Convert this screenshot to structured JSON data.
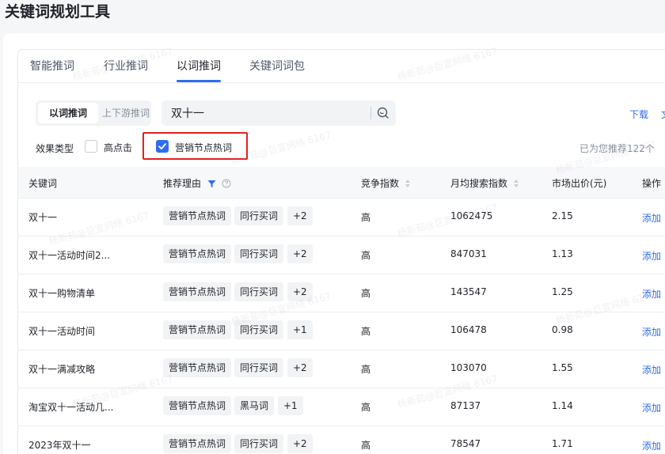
{
  "page": {
    "title": "关键词规划工具"
  },
  "tabs": [
    {
      "label": "智能推词",
      "active": false
    },
    {
      "label": "行业推词",
      "active": false
    },
    {
      "label": "以词推词",
      "active": true
    },
    {
      "label": "关键词词包",
      "active": false
    }
  ],
  "mode_switch": {
    "active": "以词推词",
    "inactive": "上下游推词"
  },
  "search": {
    "value": "双十一",
    "icon": "search-icon"
  },
  "actions": {
    "download": "下载",
    "extra": "文"
  },
  "filter": {
    "label": "效果类型",
    "options": [
      {
        "label": "高点击",
        "checked": false
      },
      {
        "label": "营销节点热词",
        "checked": true
      }
    ],
    "recommend_note": "已为您推荐122个"
  },
  "table": {
    "headers": {
      "keyword": "关键词",
      "reason": "推荐理由",
      "competition": "竞争指数",
      "monthly_search": "月均搜索指数",
      "market_bid": "市场出价(元)",
      "action": "操作"
    },
    "rows": [
      {
        "keyword": "双十一",
        "tags": [
          "营销节点热词",
          "同行买词",
          "+2"
        ],
        "competition": "高",
        "monthly_search": "1062475",
        "market_bid": "2.15",
        "action": "添加"
      },
      {
        "keyword": "双十一活动时间2...",
        "tags": [
          "营销节点热词",
          "同行买词",
          "+2"
        ],
        "competition": "高",
        "monthly_search": "847031",
        "market_bid": "1.13",
        "action": "添加"
      },
      {
        "keyword": "双十一购物清单",
        "tags": [
          "营销节点热词",
          "同行买词",
          "+2"
        ],
        "competition": "高",
        "monthly_search": "143547",
        "market_bid": "1.25",
        "action": "添加"
      },
      {
        "keyword": "双十一活动时间",
        "tags": [
          "营销节点热词",
          "同行买词",
          "+1"
        ],
        "competition": "高",
        "monthly_search": "106478",
        "market_bid": "0.98",
        "action": "添加"
      },
      {
        "keyword": "双十一满减攻略",
        "tags": [
          "营销节点热词",
          "同行买词",
          "+2"
        ],
        "competition": "高",
        "monthly_search": "103070",
        "market_bid": "1.55",
        "action": "添加"
      },
      {
        "keyword": "淘宝双十一活动几...",
        "tags": [
          "营销节点热词",
          "黑马词",
          "+1"
        ],
        "competition": "高",
        "monthly_search": "87137",
        "market_bid": "1.14",
        "action": "添加"
      },
      {
        "keyword": "2023年双十一",
        "tags": [
          "营销节点热词",
          "同行买词",
          "+2"
        ],
        "competition": "高",
        "monthly_search": "78547",
        "market_bid": "1.71",
        "action": "添加"
      }
    ]
  },
  "watermark": "杨新茹@巨宣网络 6167",
  "colors": {
    "accent": "#2f6cf6",
    "highlight": "#e02020"
  }
}
